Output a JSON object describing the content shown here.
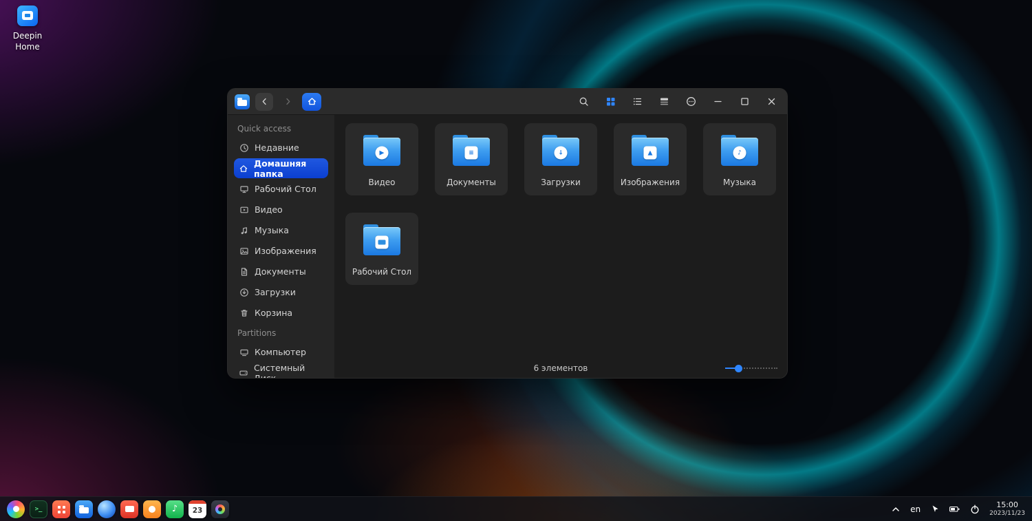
{
  "desktop": {
    "home_shortcut_label": "Deepin Home"
  },
  "file_manager": {
    "titlebar": {
      "buttons": [
        "back",
        "forward",
        "home",
        "search",
        "grid-view",
        "list-view",
        "detail-view",
        "more",
        "minimize",
        "maximize",
        "close"
      ],
      "active_view": "grid-view"
    },
    "sidebar": {
      "sections": [
        {
          "header": "Quick access",
          "items": [
            {
              "icon": "clock-icon",
              "label": "Недавние"
            },
            {
              "icon": "home-icon",
              "label": "Домашняя папка",
              "selected": true
            },
            {
              "icon": "desktop-icon",
              "label": "Рабочий Стол"
            },
            {
              "icon": "video-icon",
              "label": "Видео"
            },
            {
              "icon": "music-icon",
              "label": "Музыка"
            },
            {
              "icon": "image-icon",
              "label": "Изображения"
            },
            {
              "icon": "document-icon",
              "label": "Документы"
            },
            {
              "icon": "download-icon",
              "label": "Загрузки"
            },
            {
              "icon": "trash-icon",
              "label": "Корзина"
            }
          ]
        },
        {
          "header": "Partitions",
          "items": [
            {
              "icon": "computer-icon",
              "label": "Компьютер"
            },
            {
              "icon": "disk-icon",
              "label": "Системный Диск"
            }
          ]
        }
      ]
    },
    "folders": [
      {
        "label": "Видео",
        "emblem": "play-emblem"
      },
      {
        "label": "Документы",
        "emblem": "document-emblem"
      },
      {
        "label": "Загрузки",
        "emblem": "download-emblem"
      },
      {
        "label": "Изображения",
        "emblem": "image-emblem"
      },
      {
        "label": "Музыка",
        "emblem": "music-emblem"
      },
      {
        "label": "Рабочий Стол",
        "emblem": "desktop-emblem"
      }
    ],
    "statusbar": {
      "items_count": "6 элементов"
    }
  },
  "taskbar": {
    "apps": [
      {
        "icon": "launcher-icon"
      },
      {
        "icon": "terminal-icon",
        "glyph": ">_"
      },
      {
        "icon": "app-store-icon"
      },
      {
        "icon": "file-manager-icon"
      },
      {
        "icon": "browser-icon"
      },
      {
        "icon": "software-center-icon"
      },
      {
        "icon": "gallery-icon"
      },
      {
        "icon": "music-app-icon",
        "glyph": "♪"
      },
      {
        "icon": "calendar-icon",
        "day": "23"
      },
      {
        "icon": "control-center-icon"
      }
    ],
    "tray": {
      "language": "en",
      "time": "15:00",
      "date": "2023/11/23"
    }
  },
  "colors": {
    "accent_blue": "#2f86ff",
    "selected_blue": "#0b3fd0",
    "folder_blue": "#2f8fe0"
  }
}
